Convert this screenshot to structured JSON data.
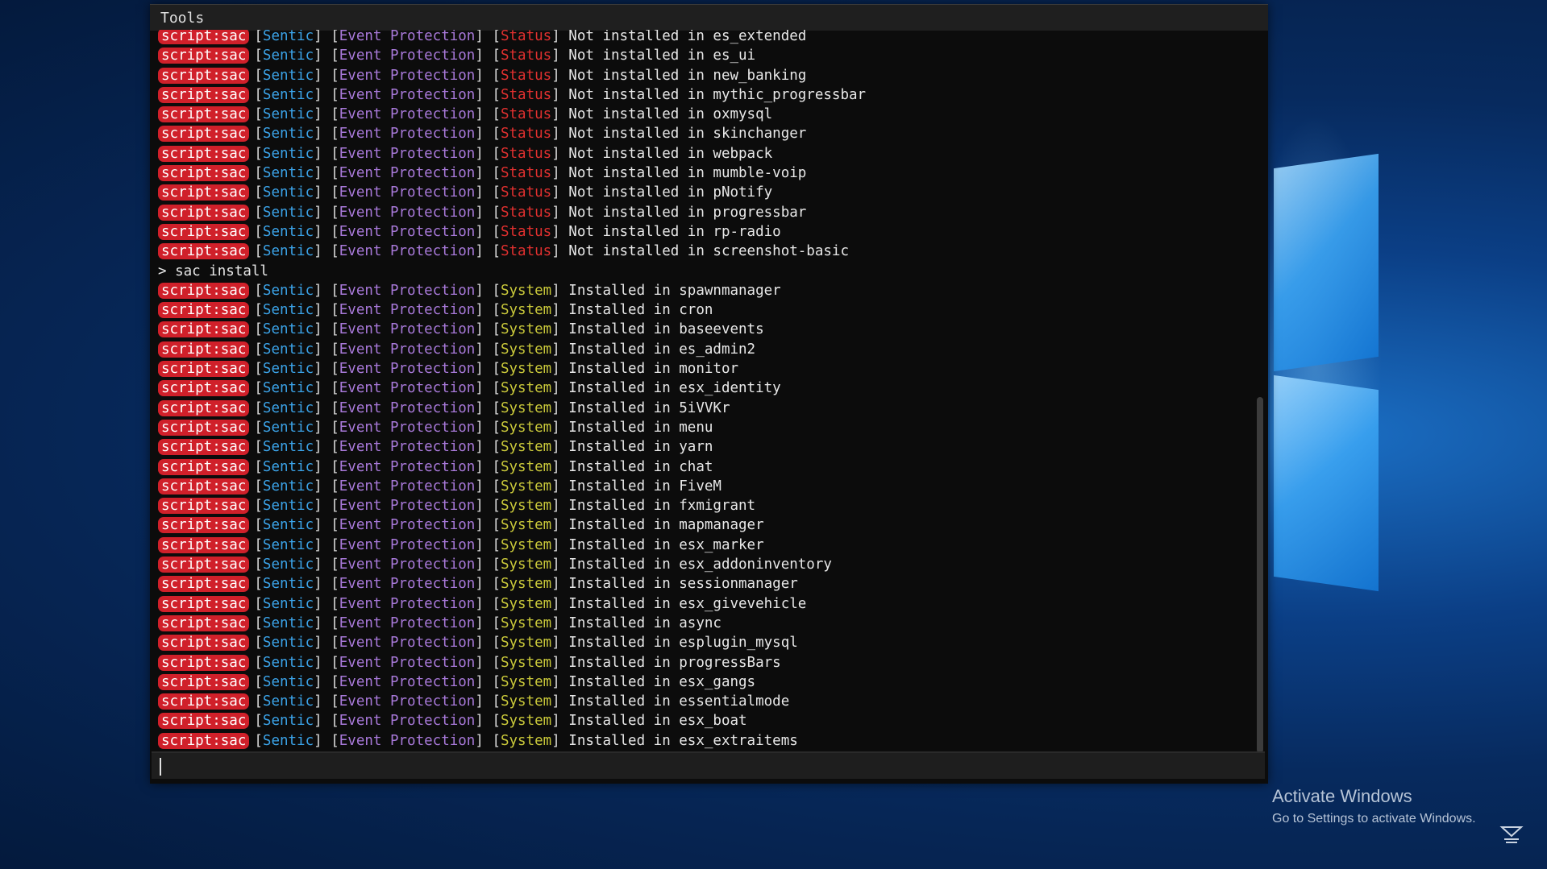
{
  "window": {
    "title": "Tools"
  },
  "tags": {
    "script": "script:sac",
    "sentic": "Sentic",
    "event": "Event Protection",
    "status": "Status",
    "system": "System"
  },
  "status_lines": [
    "Not installed in es_extended",
    "Not installed in es_ui",
    "Not installed in new_banking",
    "Not installed in mythic_progressbar",
    "Not installed in oxmysql",
    "Not installed in skinchanger",
    "Not installed in webpack",
    "Not installed in mumble-voip",
    "Not installed in pNotify",
    "Not installed in progressbar",
    "Not installed in rp-radio",
    "Not installed in screenshot-basic"
  ],
  "command": "> sac install",
  "system_lines": [
    "Installed in spawnmanager",
    "Installed in cron",
    "Installed in baseevents",
    "Installed in es_admin2",
    "Installed in monitor",
    "Installed in esx_identity",
    "Installed in 5iVVKr",
    "Installed in menu",
    "Installed in yarn",
    "Installed in chat",
    "Installed in FiveM",
    "Installed in fxmigrant",
    "Installed in mapmanager",
    "Installed in esx_marker",
    "Installed in esx_addoninventory",
    "Installed in sessionmanager",
    "Installed in esx_givevehicle",
    "Installed in async",
    "Installed in esplugin_mysql",
    "Installed in progressBars",
    "Installed in esx_gangs",
    "Installed in essentialmode",
    "Installed in esx_boat",
    "Installed in esx_extraitems"
  ],
  "input": {
    "value": ""
  },
  "watermark": {
    "title": "Activate Windows",
    "subtitle": "Go to Settings to activate Windows."
  },
  "icons": {
    "corner": "sentic-logo-icon",
    "mouse": "mouse-pointer-icon"
  },
  "colors": {
    "tag_bg": "#d0202a",
    "sentic": "#3ba3e8",
    "event": "#a879d9",
    "status": "#e0302f",
    "system": "#c9c83a"
  }
}
